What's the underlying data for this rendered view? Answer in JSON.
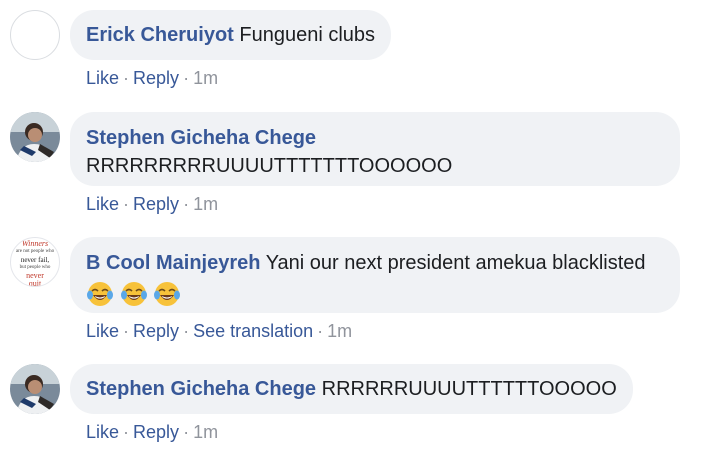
{
  "comments": [
    {
      "author": "Erick Cheruiyot",
      "text": "Fungueni clubs",
      "actions": {
        "like": "Like",
        "reply": "Reply",
        "time": "1m"
      }
    },
    {
      "author": "Stephen Gicheha Chege",
      "text": "RRRRRRRRRUUUUTTTTTTTOOOOOO",
      "actions": {
        "like": "Like",
        "reply": "Reply",
        "time": "1m"
      }
    },
    {
      "author": "B Cool Mainjeyreh",
      "text": "Yani our next president amekua blacklisted",
      "avatar_text": [
        "Winners",
        "are not people who",
        "never fail,",
        "but people who",
        "never",
        "quit"
      ],
      "emojis": [
        "tears-of-joy-emoji",
        "tears-of-joy-emoji",
        "tears-of-joy-emoji"
      ],
      "actions": {
        "like": "Like",
        "reply": "Reply",
        "see_translation": "See translation",
        "time": "1m"
      }
    },
    {
      "author": "Stephen Gicheha Chege",
      "text": "RRRRRRUUUUTTTTTTOOOOO",
      "actions": {
        "like": "Like",
        "reply": "Reply",
        "time": "1m"
      }
    }
  ],
  "colors": {
    "author": "#385898",
    "bubble": "#f0f2f5",
    "meta": "#90949c"
  }
}
